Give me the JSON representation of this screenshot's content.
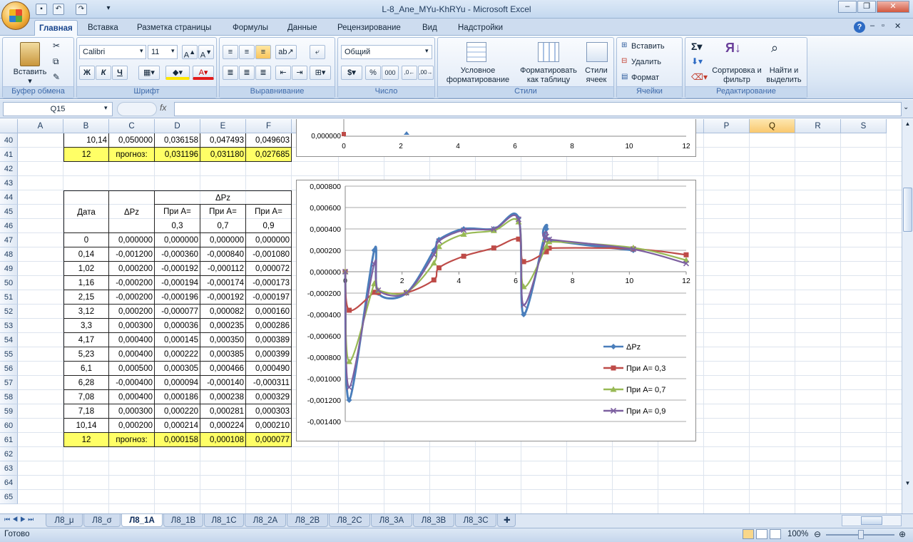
{
  "window": {
    "title": "L-8_Ane_MYu-KhRYu - Microsoft Excel"
  },
  "ribbon": {
    "tabs": [
      "Главная",
      "Вставка",
      "Разметка страницы",
      "Формулы",
      "Данные",
      "Рецензирование",
      "Вид",
      "Надстройки"
    ],
    "clipboard": {
      "paste": "Вставить",
      "label": "Буфер обмена"
    },
    "font": {
      "name": "Calibri",
      "size": "11",
      "bold": "Ж",
      "italic": "К",
      "underline": "Ч",
      "label": "Шрифт"
    },
    "alignment": {
      "label": "Выравнивание"
    },
    "number": {
      "format": "Общий",
      "label": "Число"
    },
    "styles": {
      "conditional": "Условное форматирование",
      "as_table": "Форматировать как таблицу",
      "cell_styles": "Стили ячеек",
      "label": "Стили"
    },
    "cells": {
      "insert": "Вставить",
      "delete": "Удалить",
      "format": "Формат",
      "label": "Ячейки"
    },
    "editing": {
      "sort": "Сортировка и фильтр",
      "find": "Найти и выделить",
      "label": "Редактирование"
    }
  },
  "formula_bar": {
    "name_box": "Q15",
    "fx": "fx",
    "value": ""
  },
  "columns": [
    "A",
    "B",
    "C",
    "D",
    "E",
    "F",
    "G",
    "H",
    "I",
    "J",
    "K",
    "L",
    "M",
    "N",
    "O",
    "P",
    "Q",
    "R",
    "S"
  ],
  "rows": [
    "40",
    "41",
    "42",
    "43",
    "44",
    "45",
    "46",
    "47",
    "48",
    "49",
    "50",
    "51",
    "52",
    "53",
    "54",
    "55",
    "56",
    "57",
    "58",
    "59",
    "60",
    "61",
    "62",
    "63",
    "64",
    "65"
  ],
  "table_top": {
    "row40": [
      "10,14",
      "0,050000",
      "0,036158",
      "0,047493",
      "0,049603"
    ],
    "row41": [
      "12",
      "прогноз:",
      "0,031196",
      "0,031180",
      "0,027685"
    ]
  },
  "table": {
    "header_group": "ΔPz",
    "col_date": "Дата",
    "col_dpz": "ΔPz",
    "col_a": [
      "При А=",
      "При А=",
      "При А="
    ],
    "col_a_vals": [
      "0,3",
      "0,7",
      "0,9"
    ],
    "rows": [
      [
        "0",
        "0,000000",
        "0,000000",
        "0,000000",
        "0,000000"
      ],
      [
        "0,14",
        "-0,001200",
        "-0,000360",
        "-0,000840",
        "-0,001080"
      ],
      [
        "1,02",
        "0,000200",
        "-0,000192",
        "-0,000112",
        "0,000072"
      ],
      [
        "1,16",
        "-0,000200",
        "-0,000194",
        "-0,000174",
        "-0,000173"
      ],
      [
        "2,15",
        "-0,000200",
        "-0,000196",
        "-0,000192",
        "-0,000197"
      ],
      [
        "3,12",
        "0,000200",
        "-0,000077",
        "0,000082",
        "0,000160"
      ],
      [
        "3,3",
        "0,000300",
        "0,000036",
        "0,000235",
        "0,000286"
      ],
      [
        "4,17",
        "0,000400",
        "0,000145",
        "0,000350",
        "0,000389"
      ],
      [
        "5,23",
        "0,000400",
        "0,000222",
        "0,000385",
        "0,000399"
      ],
      [
        "6,1",
        "0,000500",
        "0,000305",
        "0,000466",
        "0,000490"
      ],
      [
        "6,28",
        "-0,000400",
        "0,000094",
        "-0,000140",
        "-0,000311"
      ],
      [
        "7,08",
        "0,000400",
        "0,000186",
        "0,000238",
        "0,000329"
      ],
      [
        "7,18",
        "0,000300",
        "0,000220",
        "0,000281",
        "0,000303"
      ],
      [
        "10,14",
        "0,000200",
        "0,000214",
        "0,000224",
        "0,000210"
      ]
    ],
    "forecast": [
      "12",
      "прогноз:",
      "0,000158",
      "0,000108",
      "0,000077"
    ]
  },
  "chart_data": [
    {
      "type": "line",
      "x": [
        0,
        2,
        4,
        6,
        8,
        10,
        12
      ],
      "xlim": [
        0,
        12
      ],
      "ytick": "0,000000",
      "note": "partially visible chart above"
    },
    {
      "type": "scatter",
      "x": [
        0,
        0.14,
        1.02,
        1.16,
        2.15,
        3.12,
        3.3,
        4.17,
        5.23,
        6.1,
        6.28,
        7.08,
        7.18,
        10.14,
        12
      ],
      "xlim": [
        0,
        12
      ],
      "ylim": [
        -0.0014,
        0.0008
      ],
      "xticks": [
        "0",
        "2",
        "4",
        "6",
        "8",
        "10",
        "12"
      ],
      "yticks": [
        "0,000800",
        "0,000600",
        "0,000400",
        "0,000200",
        "0,000000",
        "-0,000200",
        "-0,000400",
        "-0,000600",
        "-0,000800",
        "-0,001000",
        "-0,001200",
        "-0,001400"
      ],
      "series": [
        {
          "name": "ΔPz",
          "color": "#4a7ebb",
          "marker": "diamond",
          "values": [
            0,
            -0.0012,
            0.0002,
            -0.0002,
            -0.0002,
            0.0002,
            0.0003,
            0.0004,
            0.0004,
            0.0005,
            -0.0004,
            0.0004,
            0.0003,
            0.0002,
            null
          ]
        },
        {
          "name": "При А= 0,3",
          "color": "#be4b48",
          "marker": "square",
          "values": [
            0,
            -0.00036,
            -0.000192,
            -0.000194,
            -0.000196,
            -7.7e-05,
            3.6e-05,
            0.000145,
            0.000222,
            0.000305,
            9.4e-05,
            0.000186,
            0.00022,
            0.000214,
            0.000158
          ]
        },
        {
          "name": "При А= 0,7",
          "color": "#98b954",
          "marker": "triangle",
          "values": [
            0,
            -0.00084,
            -0.000112,
            -0.000174,
            -0.000192,
            8.2e-05,
            0.000235,
            0.00035,
            0.000385,
            0.000466,
            -0.00014,
            0.000238,
            0.000281,
            0.000224,
            0.000108
          ]
        },
        {
          "name": "При А= 0,9",
          "color": "#7d60a0",
          "marker": "x",
          "values": [
            0,
            -0.00108,
            7.2e-05,
            -0.000173,
            -0.000197,
            0.00016,
            0.000286,
            0.000389,
            0.000399,
            0.00049,
            -0.000311,
            0.000329,
            0.000303,
            0.00021,
            7.7e-05
          ]
        }
      ],
      "legend": "right"
    }
  ],
  "sheets": [
    "Л8_μ",
    "Л8_σ",
    "Л8_1А",
    "Л8_1В",
    "Л8_1С",
    "Л8_2А",
    "Л8_2В",
    "Л8_2С",
    "Л8_3А",
    "Л8_3В",
    "Л8_3С"
  ],
  "active_sheet": 2,
  "status": {
    "ready": "Готово",
    "zoom": "100%"
  }
}
